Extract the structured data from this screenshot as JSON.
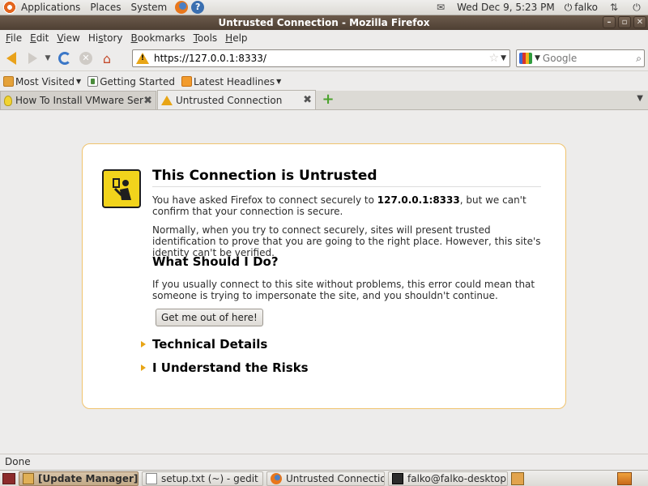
{
  "top_panel": {
    "menus": [
      "Applications",
      "Places",
      "System"
    ],
    "clock": "Wed Dec  9,  5:23 PM",
    "user": "falko"
  },
  "window": {
    "title": "Untrusted Connection - Mozilla Firefox"
  },
  "menubar": {
    "items": [
      {
        "accel": "F",
        "rest": "ile"
      },
      {
        "accel": "E",
        "rest": "dit"
      },
      {
        "accel": "V",
        "rest": "iew"
      },
      {
        "accel": "",
        "pre": "Hi",
        "accel2": "s",
        "rest": "tory"
      },
      {
        "accel": "B",
        "rest": "ookmarks"
      },
      {
        "accel": "T",
        "rest": "ools"
      },
      {
        "accel": "H",
        "rest": "elp"
      }
    ],
    "labels": [
      "File",
      "Edit",
      "View",
      "History",
      "Bookmarks",
      "Tools",
      "Help"
    ]
  },
  "navbar": {
    "url": "https://127.0.0.1:8333/",
    "search_placeholder": "Google"
  },
  "bookmarks": {
    "most_visited": "Most Visited",
    "getting_started": "Getting Started",
    "latest_headlines": "Latest Headlines"
  },
  "tabs": [
    {
      "label": "How To Install VMware Ser...",
      "active": false
    },
    {
      "label": "Untrusted Connection",
      "active": true
    }
  ],
  "error_page": {
    "title": "This Connection is Untrusted",
    "para1_a": "You have asked Firefox to connect securely to ",
    "para1_host": "127.0.0.1:8333",
    "para1_b": ", but we can't confirm that your connection is secure.",
    "para2": "Normally, when you try to connect securely, sites will present trusted identification to prove that you are going to the right place. However, this site's identity can't be verified.",
    "what_heading": "What Should I Do?",
    "para3": "If you usually connect to this site without problems, this error could mean that someone is trying to impersonate the site, and you shouldn't continue.",
    "escape_button": "Get me out of here!",
    "technical_details": "Technical Details",
    "understand_risks": "I Understand the Risks"
  },
  "statusbar": {
    "text": "Done"
  },
  "taskbar": {
    "tasks": [
      {
        "label": "[Update Manager]",
        "active": true
      },
      {
        "label": "setup.txt (~) - gedit",
        "active": false
      },
      {
        "label": "Untrusted Connectio...",
        "active": false
      },
      {
        "label": "falko@falko-desktop...",
        "active": false
      }
    ]
  },
  "colors": {
    "titlebar": "#5a4a3d",
    "error_border": "#f0c36d",
    "warning_yellow": "#e8a516"
  }
}
